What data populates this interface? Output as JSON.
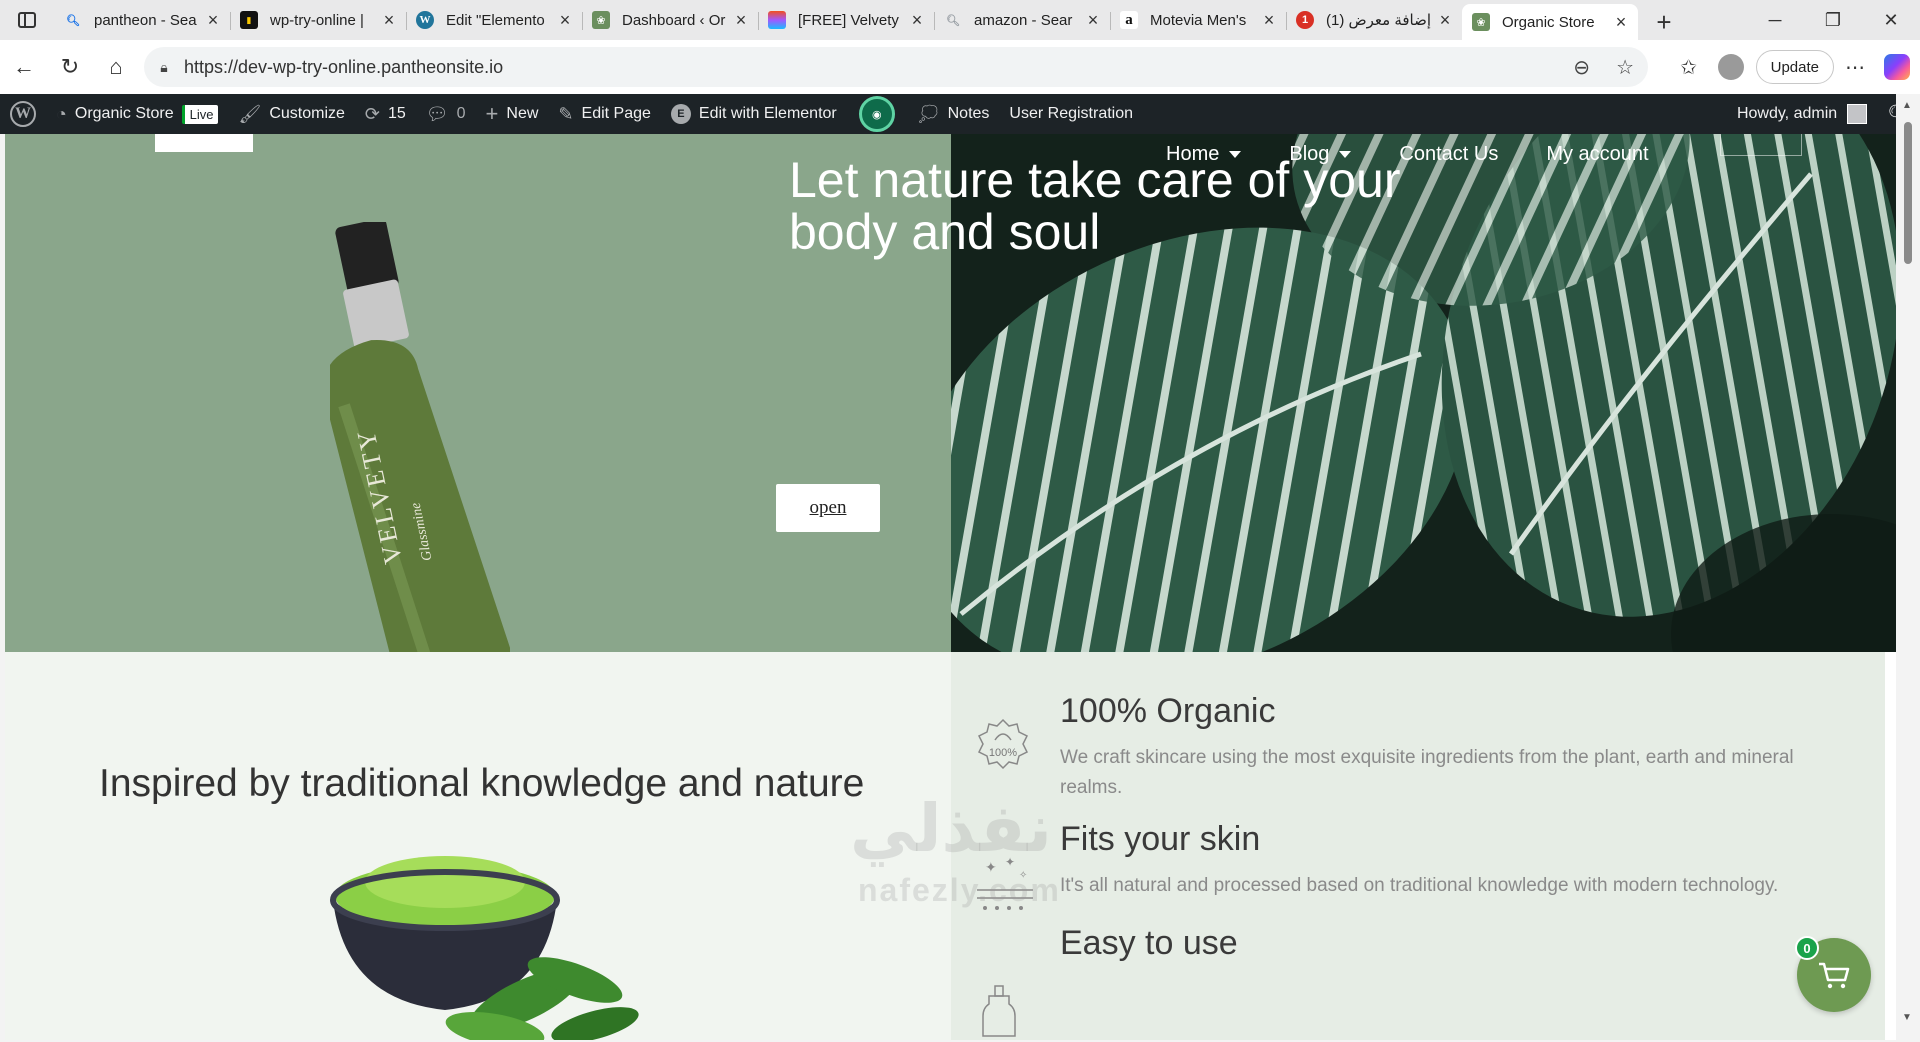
{
  "browser": {
    "tabs": [
      {
        "title": "pantheon - Sea",
        "favicon": "search-favicon",
        "color": "#1a73e8"
      },
      {
        "title": "wp-try-online |",
        "favicon": "pantheon-favicon",
        "color": "#f7c600"
      },
      {
        "title": "Edit \"Elemento",
        "favicon": "wordpress-favicon",
        "color": "#21759b"
      },
      {
        "title": "Dashboard ‹ Or",
        "favicon": "organic-favicon",
        "color": "#6b8f5e"
      },
      {
        "title": "[FREE] Velvety",
        "favicon": "figma-favicon",
        "color": "#f24e1e"
      },
      {
        "title": "amazon - Sear",
        "favicon": "search-favicon",
        "color": "#1a73e8"
      },
      {
        "title": "Motevia Men's",
        "favicon": "amazon-favicon",
        "color": "#111111"
      },
      {
        "title": "(1) إضافة معرض",
        "favicon": "notification-favicon",
        "color": "#d93025"
      },
      {
        "title": "Organic Store",
        "favicon": "organic-favicon",
        "color": "#6b8f5e",
        "active": true
      }
    ],
    "url": "https://dev-wp-try-online.pantheonsite.io",
    "update_label": "Update"
  },
  "wpbar": {
    "site_name": "Organic Store",
    "live": "Live",
    "customize": "Customize",
    "updates_count": "15",
    "comments_count": "0",
    "new": "New",
    "edit_page": "Edit Page",
    "edit_elementor": "Edit with Elementor",
    "notes": "Notes",
    "user_registration": "User Registration",
    "howdy": "Howdy, admin"
  },
  "nav": {
    "home": "Home",
    "blog": "Blog",
    "contact": "Contact Us",
    "account": "My account"
  },
  "hero": {
    "title": "Let nature take care of your body and soul",
    "button": "open",
    "bottle_brand": "VELVETY",
    "bottle_sub": "Glassmine"
  },
  "inspired": "Inspired by traditional knowledge and nature",
  "features": [
    {
      "title": "100% Organic",
      "desc": "We craft skincare using the most exquisite ingredients from the plant, earth and mineral realms.",
      "icon": "organic-badge-icon",
      "badge": "100%"
    },
    {
      "title": "Fits your skin",
      "desc": "It's all natural and processed based on traditional knowledge with modern technology.",
      "icon": "sparkle-skin-icon"
    },
    {
      "title": "Easy to use",
      "desc": "",
      "icon": "bottle-icon"
    }
  ],
  "cart": {
    "count": "0"
  },
  "watermark": {
    "arabic": "نفذلي",
    "latin": "nafezly.com"
  },
  "colors": {
    "hero_sage": "#8aa68b",
    "wp_bar": "#1d2327",
    "accent_green": "#6e9a52",
    "lower_left_bg": "#f1f5f0",
    "lower_right_bg": "#e6ede5"
  }
}
